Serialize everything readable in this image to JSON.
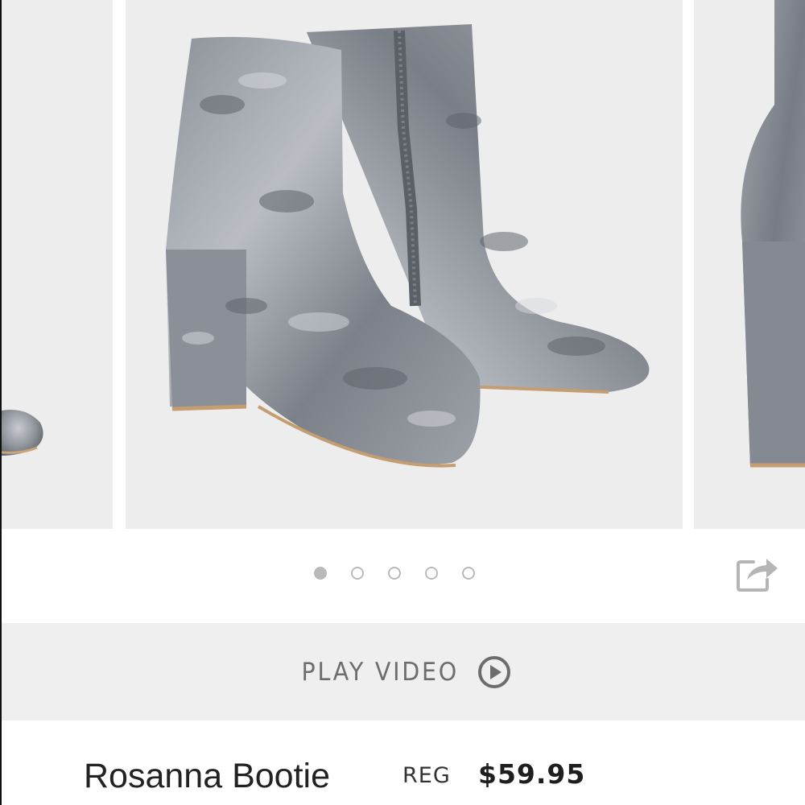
{
  "carousel": {
    "total_slides": 5,
    "active_index": 0,
    "image_subject": "grey crushed velvet ankle booties"
  },
  "actions": {
    "share_icon": "share-icon"
  },
  "video": {
    "label": "PLAY VIDEO",
    "icon": "play-circle-icon"
  },
  "product": {
    "name": "Rosanna Bootie",
    "price_label": "REG",
    "price": "$59.95"
  },
  "colors": {
    "accent_grey": "#6d6d6d",
    "bar_background": "#efefef",
    "dot": "#b9b9b9"
  }
}
